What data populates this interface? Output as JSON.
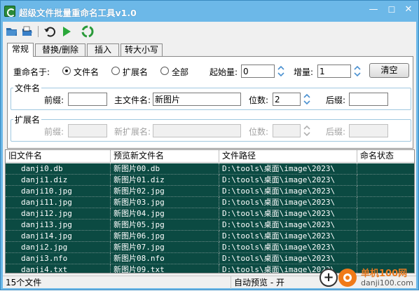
{
  "window": {
    "title": "超级文件批量重命名工具v1.0",
    "min": "—",
    "max": "☐",
    "close": "✕"
  },
  "toolbar": {
    "icons": [
      "open-folder-icon",
      "open-file-icon",
      "undo-icon",
      "run-icon",
      "recycle-icon"
    ]
  },
  "tabs": [
    "常规",
    "替换/删除",
    "插入",
    "转大小写"
  ],
  "rename_to": {
    "label": "重命名于:",
    "options": [
      "文件名",
      "扩展名",
      "全部"
    ],
    "selected": "文件名"
  },
  "start": {
    "label": "起始量:",
    "value": "0"
  },
  "step": {
    "label": "增量:",
    "value": "1"
  },
  "clear_button": "清空",
  "filename_group": {
    "title": "文件名",
    "prefix_label": "前缀:",
    "prefix_value": "",
    "main_label": "主文件名:",
    "main_value": "新图片",
    "digits_label": "位数:",
    "digits_value": "2",
    "suffix_label": "后缀:",
    "suffix_value": ""
  },
  "ext_group": {
    "title": "扩展名",
    "prefix_label": "前缀:",
    "new_ext_label": "新扩展名:",
    "digits_label": "位数:",
    "suffix_label": "后缀:"
  },
  "table": {
    "columns": [
      "旧文件名",
      "预览新文件名",
      "文件路径",
      "命名状态"
    ],
    "rows": [
      [
        "danji0.db",
        "新图片00.db",
        "D:\\tools\\桌面\\image\\2023\\",
        ""
      ],
      [
        "danji1.diz",
        "新图片01.diz",
        "D:\\tools\\桌面\\image\\2023\\",
        ""
      ],
      [
        "danji10.jpg",
        "新图片02.jpg",
        "D:\\tools\\桌面\\image\\2023\\",
        ""
      ],
      [
        "danji11.jpg",
        "新图片03.jpg",
        "D:\\tools\\桌面\\image\\2023\\",
        ""
      ],
      [
        "danji12.jpg",
        "新图片04.jpg",
        "D:\\tools\\桌面\\image\\2023\\",
        ""
      ],
      [
        "danji13.jpg",
        "新图片05.jpg",
        "D:\\tools\\桌面\\image\\2023\\",
        ""
      ],
      [
        "danji14.jpg",
        "新图片06.jpg",
        "D:\\tools\\桌面\\image\\2023\\",
        ""
      ],
      [
        "danji2.jpg",
        "新图片07.jpg",
        "D:\\tools\\桌面\\image\\2023\\",
        ""
      ],
      [
        "danji3.nfo",
        "新图片08.nfo",
        "D:\\tools\\桌面\\image\\2023\\",
        ""
      ],
      [
        "danji4.txt",
        "新图片09.txt",
        "D:\\tools\\桌面\\image\\2023\\",
        ""
      ]
    ]
  },
  "status": {
    "count": "15个文件",
    "preview": "自动预览 - 开"
  },
  "watermark": {
    "site_cn": "单机100网",
    "site_url": "danji100.com"
  },
  "colors": {
    "titlebar": "#6cb8e8",
    "row_bg": "#0b4a42",
    "accent_green": "#2a8a3a"
  }
}
